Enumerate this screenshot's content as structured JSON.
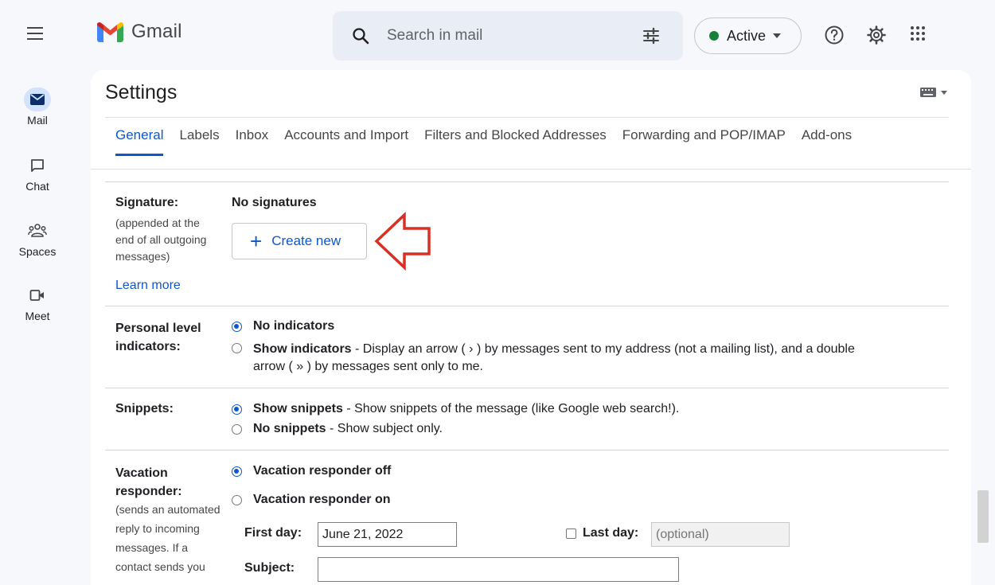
{
  "app": {
    "name": "Gmail"
  },
  "nav": {
    "items": [
      {
        "label": "Mail",
        "icon": "mail-icon"
      },
      {
        "label": "Chat",
        "icon": "chat-icon"
      },
      {
        "label": "Spaces",
        "icon": "spaces-icon"
      },
      {
        "label": "Meet",
        "icon": "meet-icon"
      }
    ]
  },
  "search": {
    "placeholder": "Search in mail"
  },
  "status": {
    "label": "Active",
    "color": "#188038"
  },
  "settings": {
    "title": "Settings",
    "tabs": [
      "General",
      "Labels",
      "Inbox",
      "Accounts and Import",
      "Filters and Blocked Addresses",
      "Forwarding and POP/IMAP",
      "Add-ons"
    ],
    "active_tab": "General"
  },
  "signature": {
    "label": "Signature:",
    "help_lines": [
      "(appended at the",
      "end of all outgoing",
      "messages)"
    ],
    "learn_more": "Learn more",
    "status": "No signatures",
    "create_button": "Create new"
  },
  "personal_indicators": {
    "label_lines": [
      "Personal level",
      "indicators:"
    ],
    "option_none": "No indicators",
    "option_show_title": "Show indicators",
    "option_show_desc_1": " - Display an arrow ( › ) by messages sent to my address (not a mailing list), and a double",
    "option_show_desc_2": "arrow ( » ) by messages sent only to me."
  },
  "snippets": {
    "label": "Snippets:",
    "option_show_title": "Show snippets",
    "option_show_desc": " - Show snippets of the message (like Google web search!).",
    "option_none_title": "No snippets",
    "option_none_desc": " - Show subject only."
  },
  "vacation": {
    "label_lines": [
      "Vacation",
      "responder:"
    ],
    "help_lines": [
      "(sends an automated",
      "reply to incoming",
      "messages. If a",
      "contact sends you"
    ],
    "option_off": "Vacation responder off",
    "option_on": "Vacation responder on",
    "first_day_label": "First day:",
    "first_day_value": "June 21, 2022",
    "last_day_label": "Last day:",
    "last_day_placeholder": "(optional)",
    "subject_label": "Subject:"
  },
  "colors": {
    "accent": "#0b57d0",
    "annotation_arrow": "#d93025"
  }
}
